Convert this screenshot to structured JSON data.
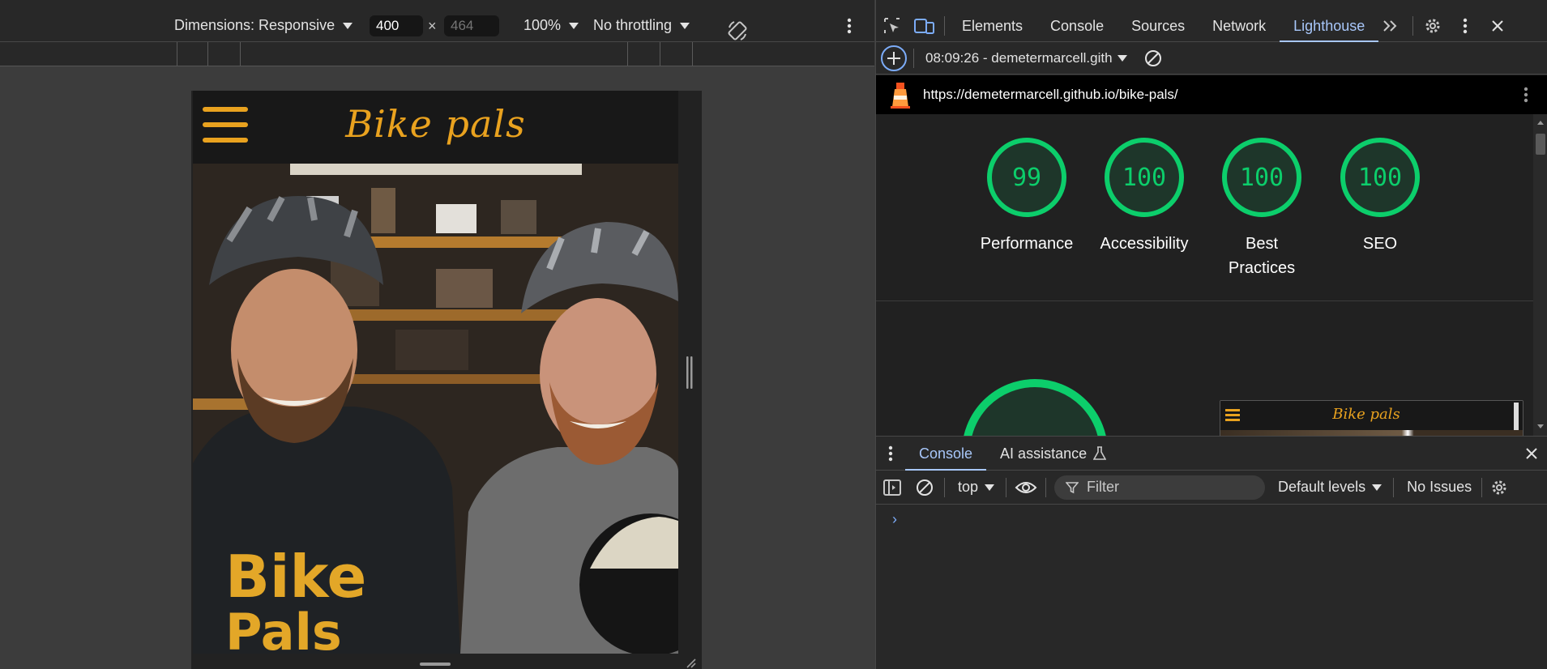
{
  "device_toolbar": {
    "dimensions_label": "Dimensions: Responsive",
    "width_value": "400",
    "times": "×",
    "height_placeholder": "464",
    "zoom": "100%",
    "throttling": "No throttling"
  },
  "site": {
    "logo_text": "Bike pals"
  },
  "devtools": {
    "tabs": [
      "Elements",
      "Console",
      "Sources",
      "Network",
      "Lighthouse"
    ],
    "active_tab": "Lighthouse",
    "lighthouse": {
      "report_select": "08:09:26 - demetermarcell.gith",
      "url": "https://demetermarcell.github.io/bike-pals/",
      "scores": [
        {
          "value": "99",
          "label": "Performance"
        },
        {
          "value": "100",
          "label": "Accessibility"
        },
        {
          "value": "100",
          "label": "Best Practices"
        },
        {
          "value": "100",
          "label": "SEO"
        }
      ],
      "thumb_logo": "Bike pals",
      "score_color": "#0cce6b"
    },
    "drawer": {
      "tabs": [
        "Console",
        "AI assistance"
      ],
      "context": "top",
      "filter_placeholder": "Filter",
      "levels": "Default levels",
      "issues": "No Issues",
      "prompt": "›"
    },
    "accent_color": "#a8c7fa"
  }
}
